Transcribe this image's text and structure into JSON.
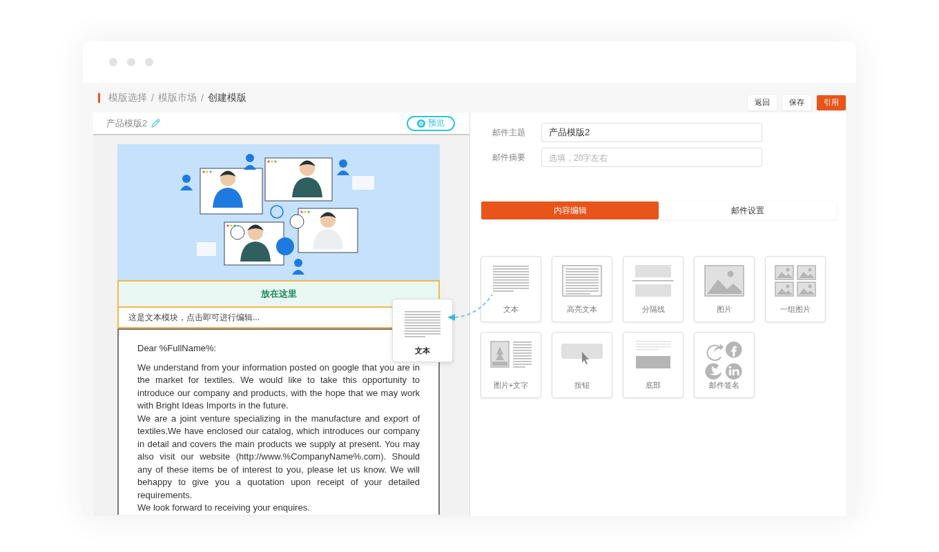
{
  "breadcrumb": [
    {
      "label": "模版选择",
      "current": false
    },
    {
      "separator": "/",
      "label": "模版市场",
      "current": false
    },
    {
      "separator": "/",
      "label": "创建模版",
      "current": true
    }
  ],
  "actions": [
    {
      "label": "返回",
      "primary": false
    },
    {
      "label": "保存",
      "primary": false
    },
    {
      "label": "引用",
      "primary": true
    }
  ],
  "template": {
    "name": "产品模版2",
    "preview_label": "预览"
  },
  "email": {
    "drop_zone": "放在这里",
    "text_module": "这是文本模块，点击即可进行编辑...",
    "greeting": "Dear %FullName%:",
    "paragraphs": [
      "We understand from your information posted on google that you are in the market for textiles. We would like to take this opportunity to introduce our company and products, with the hope that we may work with Bright Ideas Imports in the future.",
      "We are a joint venture specializing in the manufacture and export of textiles.We have enclosed our catalog, which introduces our company in detail and covers the main products we supply at present. You may also visit our website (http://www.%CompanyName%.com). Should any of these items be of interest to you, please let us know. We will behappy to give you a quotation upon receipt of your detailed requirements.",
      "We look forward to receiving your enquires."
    ]
  },
  "dragged_block": {
    "kind": "text",
    "label": "文本"
  },
  "form": [
    {
      "label": "邮件主题",
      "value": "产品模版2"
    },
    {
      "label": "邮件摘要",
      "placeholder": "选填，20字左右"
    }
  ],
  "tabs": [
    {
      "label": "内容编辑",
      "selected": true
    },
    {
      "label": "邮件设置",
      "selected": false
    }
  ],
  "blocks": [
    {
      "kind": "text",
      "label": "文本"
    },
    {
      "kind": "highlight",
      "label": "高亮文本"
    },
    {
      "kind": "divider",
      "label": "分隔线"
    },
    {
      "kind": "image",
      "label": "图片"
    },
    {
      "kind": "gallery",
      "label": "一组图片"
    },
    {
      "kind": "image_text",
      "label": "图片+文字"
    },
    {
      "kind": "button",
      "label": "按钮"
    },
    {
      "kind": "footer",
      "label": "底部"
    },
    {
      "kind": "signature",
      "label": "邮件签名"
    }
  ]
}
